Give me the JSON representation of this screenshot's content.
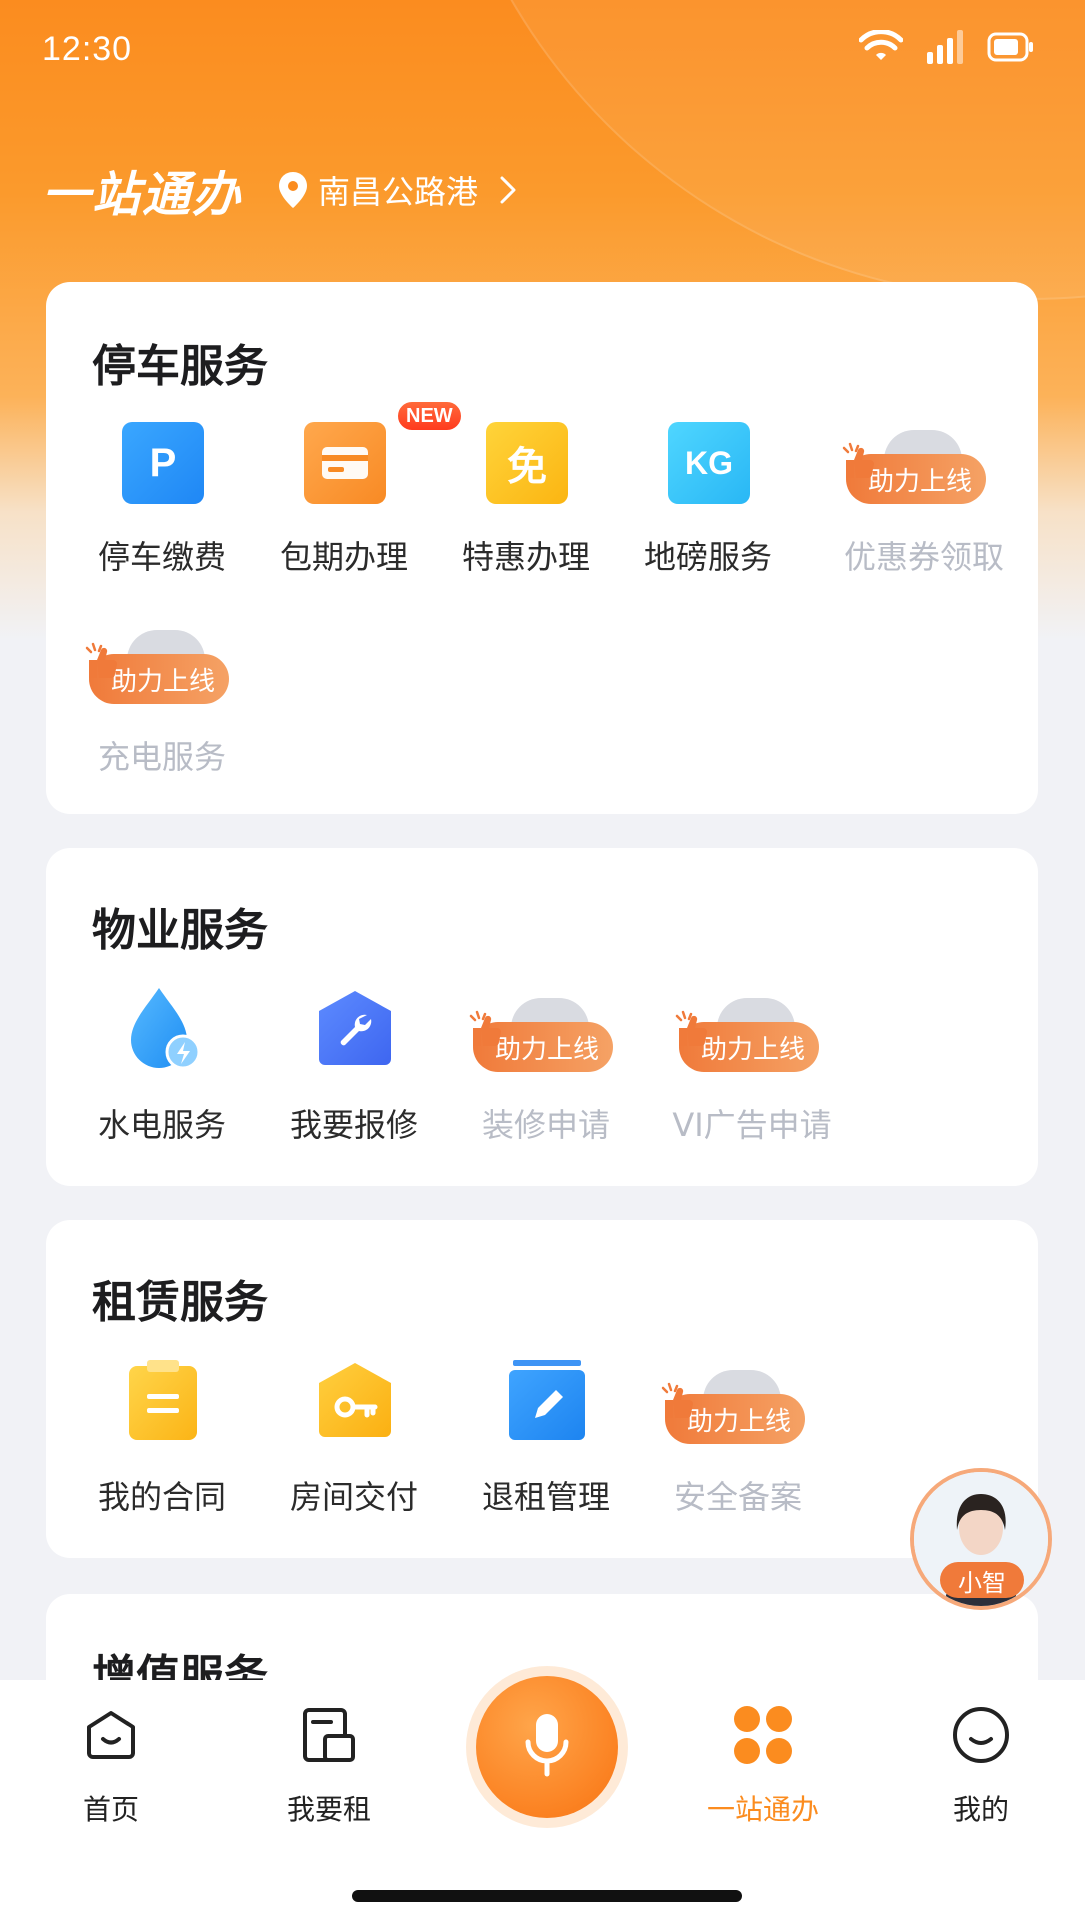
{
  "statusbar": {
    "time": "12:30"
  },
  "header": {
    "title": "一站通办",
    "location": "南昌公路港"
  },
  "assist_badge": "助力上线",
  "new_badge": "NEW",
  "parking": {
    "title": "停车服务",
    "items": [
      {
        "label": "停车缴费",
        "icon": "P"
      },
      {
        "label": "包期办理"
      },
      {
        "label": "特惠办理",
        "icon": "免"
      },
      {
        "label": "地磅服务",
        "icon": "KG"
      },
      {
        "label": "优惠券领取"
      },
      {
        "label": "充电服务"
      }
    ]
  },
  "property": {
    "title": "物业服务",
    "items": [
      {
        "label": "水电服务"
      },
      {
        "label": "我要报修"
      },
      {
        "label": "装修申请"
      },
      {
        "label": "VI广告申请"
      }
    ]
  },
  "lease": {
    "title": "租赁服务",
    "items": [
      {
        "label": "我的合同"
      },
      {
        "label": "房间交付"
      },
      {
        "label": "退租管理"
      },
      {
        "label": "安全备案"
      }
    ]
  },
  "value_added": {
    "title": "增值服务"
  },
  "assistant": {
    "name": "小智"
  },
  "nav": {
    "home": "首页",
    "rent": "我要租",
    "one_stop": "一站通办",
    "mine": "我的"
  },
  "colors": {
    "brand": "#fb8c1f",
    "assist": "#f07a3a",
    "disabled_text": "#b8bcc6"
  }
}
